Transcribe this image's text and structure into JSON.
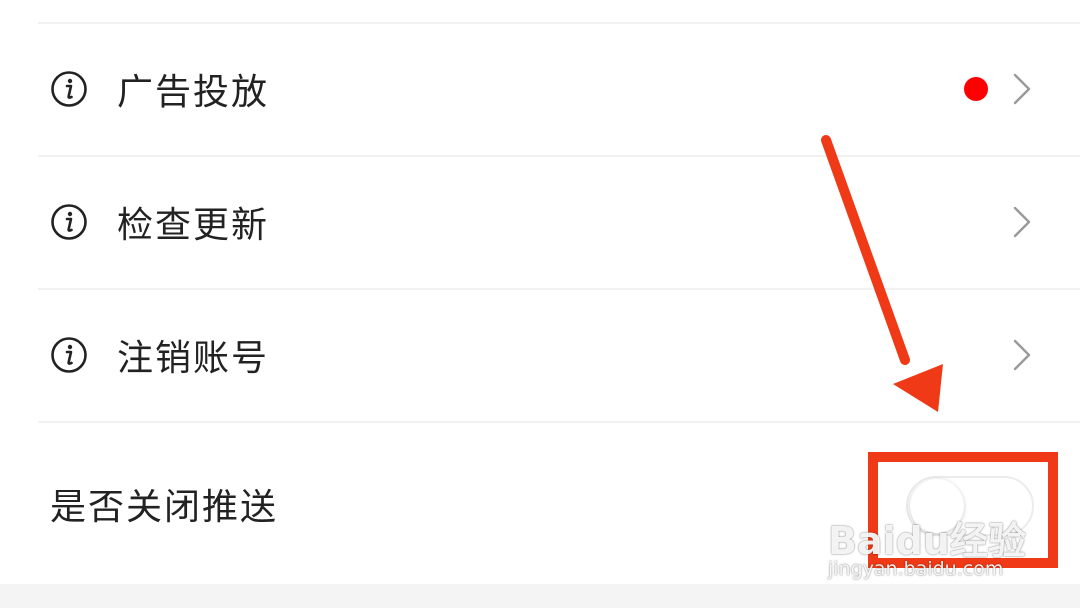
{
  "settings": {
    "items": [
      {
        "label": "广告投放",
        "icon": "info-icon",
        "has_badge": true,
        "badge_color": "#ff0000"
      },
      {
        "label": "检查更新",
        "icon": "info-icon",
        "has_badge": false
      },
      {
        "label": "注销账号",
        "icon": "info-icon",
        "has_badge": false
      }
    ],
    "push_toggle": {
      "label": "是否关闭推送",
      "state": "off"
    }
  },
  "annotation": {
    "color": "#f03a17"
  },
  "watermark": {
    "brand": "Baidu经验",
    "url": "jingyan.baidu.com"
  }
}
